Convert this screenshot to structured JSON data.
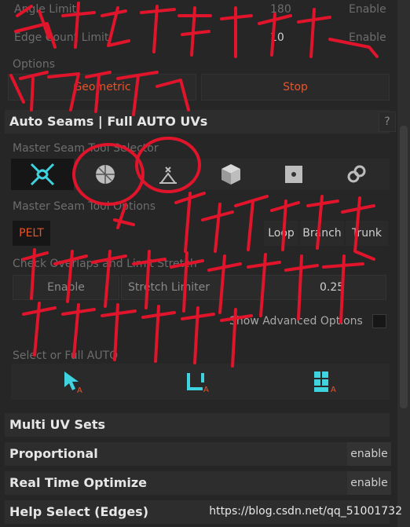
{
  "top_rows": [
    {
      "label": "Angle Limit",
      "value": "180",
      "toggle": "Enable"
    },
    {
      "label": "Edge Count Limit",
      "value": "10",
      "toggle": "Enable"
    }
  ],
  "options_label": "Options",
  "geometric_label": "Geometric",
  "stop_label": "Stop",
  "auto_seams": {
    "title": "Auto Seams | Full AUTO UVs",
    "help": "?",
    "selector_label": "Master Seam Tool Selector",
    "options_label": "Master Seam Tool Options",
    "pelt_label": "PELT",
    "loop_label": "Loop",
    "branch_label": "Branch",
    "trunk_label": "Trunk",
    "check_label": "Check Overlaps and Limit Stretch",
    "enable_label": "Enable",
    "stretch_label": "Stretch Limiter",
    "stretch_value": "0.25",
    "advanced_label": "Show Advanced Options",
    "select_label": "Select or Full AUTO"
  },
  "sections": [
    {
      "title": "Multi UV Sets",
      "button": ""
    },
    {
      "title": "Proportional",
      "button": "enable"
    },
    {
      "title": "Real Time Optimize",
      "button": "enable"
    },
    {
      "title": "Help Select (Edges)",
      "button": ""
    }
  ],
  "watermark": "https://blog.csdn.net/qq_51001732",
  "colors": {
    "accent": "#e8542a",
    "icon": "#3fd3e0",
    "annotation": "#e0142b"
  }
}
